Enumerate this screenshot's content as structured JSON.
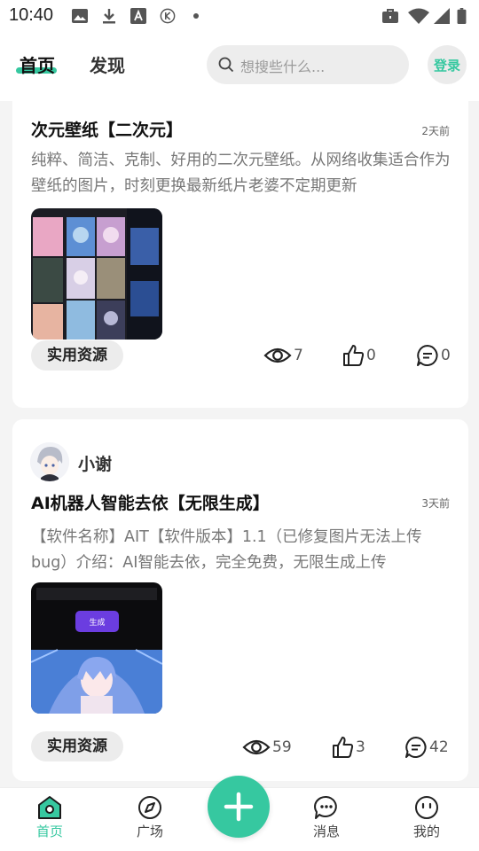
{
  "status_bar": {
    "time": "10:40",
    "left_icons": [
      "image-icon",
      "download-icon",
      "font-a-icon",
      "k-circle-icon",
      "dot-icon"
    ],
    "right_icons": [
      "briefcase-icon",
      "wifi-icon",
      "cell-signal-icon",
      "battery-icon"
    ]
  },
  "top_nav": {
    "tabs": [
      {
        "label": "首页",
        "active": true
      },
      {
        "label": "发现",
        "active": false
      }
    ],
    "search": {
      "placeholder": "想搜些什么..."
    },
    "login_label": "登录",
    "accent_color": "#36c8a0"
  },
  "posts": [
    {
      "title": "次元壁纸【二次元】",
      "time": "2天前",
      "description": "纯粹、简洁、克制、好用的二次元壁纸。从网络收集适合作为壁纸的图片，时刻更换最新纸片老婆不定期更新",
      "tag": "实用资源",
      "views": "7",
      "likes": "0",
      "comments": "0"
    },
    {
      "author": "小谢",
      "title": "AI机器人智能去依【无限生成】",
      "time": "3天前",
      "description": "【软件名称】AIT【软件版本】1.1（已修复图片无法上传bug）介绍：AI智能去依，完全免费，无限生成上传",
      "image_button_label": "生成",
      "tag": "实用资源",
      "views": "59",
      "likes": "3",
      "comments": "42"
    }
  ],
  "bottom_nav": {
    "items": [
      {
        "label": "首页",
        "icon": "home-icon",
        "active": true
      },
      {
        "label": "广场",
        "icon": "compass-icon",
        "active": false
      },
      {
        "label": "消息",
        "icon": "chat-icon",
        "active": false
      },
      {
        "label": "我的",
        "icon": "profile-icon",
        "active": false
      }
    ],
    "fab_icon": "plus-icon"
  }
}
